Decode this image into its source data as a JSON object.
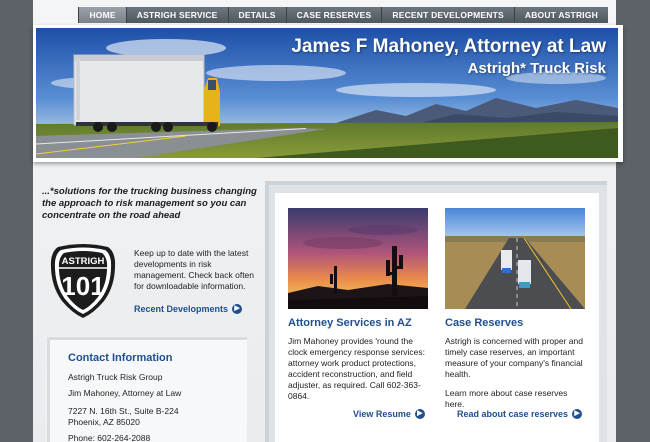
{
  "nav": {
    "items": [
      {
        "label": "HOME",
        "active": true
      },
      {
        "label": "ASTRIGH SERVICE",
        "active": false
      },
      {
        "label": "DETAILS",
        "active": false
      },
      {
        "label": "CASE RESERVES",
        "active": false
      },
      {
        "label": "RECENT DEVELOPMENTS",
        "active": false
      },
      {
        "label": "ABOUT ASTRIGH",
        "active": false
      }
    ]
  },
  "banner": {
    "title": "James F Mahoney, Attorney at Law",
    "subtitle": "Astrigh* Truck Risk"
  },
  "tagline": "...*solutions for the trucking business changing the approach to risk management so you can concentrate on the road ahead",
  "shield": {
    "top_text": "ASTRIGH",
    "number": "101"
  },
  "updates": {
    "text": "Keep up to date with the latest developments in risk management. Check back often for downloadable information.",
    "link_label": "Recent Developments"
  },
  "contact": {
    "title": "Contact Information",
    "group": "Astrigh Truck Risk Group",
    "name": "Jim Mahoney, Attorney at Law",
    "address1": "7227 N. 16th St., Suite B-224",
    "address2": "Phoenix, AZ 85020",
    "phone": "Phone: 602-264-2088"
  },
  "cards": [
    {
      "title": "Attorney Services in AZ",
      "text": "Jim Mahoney provides 'round the clock emergency response services: attorney work product protections, accident reconstruction, and field adjuster, as required. Call 602-363-0864.",
      "link_label": "View Resume"
    },
    {
      "title": "Case Reserves",
      "text": "Astrigh is concerned with proper and timely case reserves, an important measure of your company's financial health.",
      "text2": "Learn more about case reserves here.",
      "link_label": "Read about case reserves"
    }
  ],
  "colors": {
    "link": "#1f4f8f",
    "background": "#5c6268",
    "nav": "#5a6168"
  }
}
